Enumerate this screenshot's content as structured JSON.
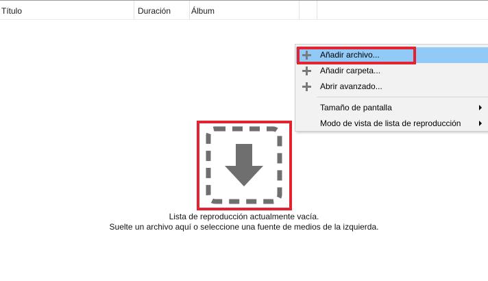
{
  "columns": {
    "title": "Título",
    "duration": "Duración",
    "album": "Álbum"
  },
  "empty_state": {
    "line1": "Lista de reproducción actualmente vacía.",
    "line2": "Suelte un archivo aquí o seleccione una fuente de medios de la izquierda.",
    "icon": "drop-arrow-icon"
  },
  "context_menu": {
    "items": [
      {
        "label": "Añadir archivo...",
        "icon": "plus-icon",
        "highlighted": true
      },
      {
        "label": "Añadir carpeta...",
        "icon": "plus-icon"
      },
      {
        "label": "Abrir avanzado...",
        "icon": "plus-icon"
      },
      {
        "label": "Tamaño de pantalla",
        "submenu": true
      },
      {
        "label": "Modo de vista de lista de reproducción",
        "submenu": true
      }
    ]
  },
  "colors": {
    "highlight_outline": "#e3232f",
    "menu_hover": "#91c9f7",
    "icon_gray": "#6f6f6f",
    "menu_background": "#f2f2f2"
  }
}
